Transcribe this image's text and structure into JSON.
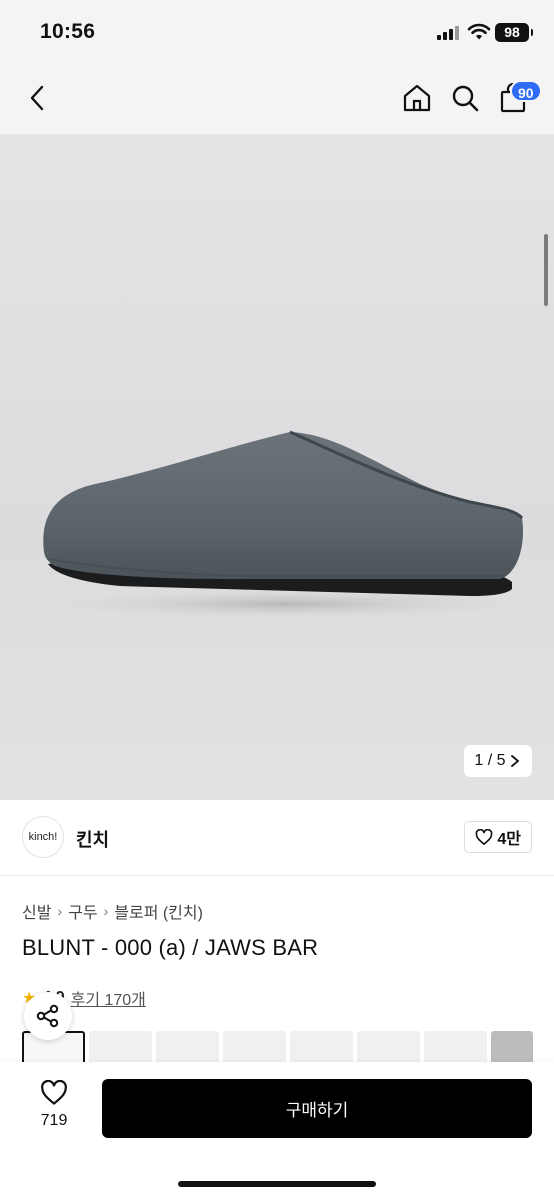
{
  "status_bar": {
    "time": "10:56",
    "battery": "98"
  },
  "nav": {
    "back_icon": "chevron-left-icon",
    "home_icon": "home-icon",
    "search_icon": "search-icon",
    "cart_icon": "shopping-bag-icon",
    "cart_count": "90"
  },
  "gallery": {
    "counter": "1 / 5",
    "next_icon": "chevron-right-icon"
  },
  "brand": {
    "logo_text": "kinch!",
    "name": "킨치",
    "like_count": "4만"
  },
  "breadcrumb": [
    "신발",
    "구두",
    "블로퍼 (킨치)"
  ],
  "product": {
    "title": "BLUNT - 000 (a) / JAWS BAR",
    "rating": "4.9",
    "review_link": "후기 170개"
  },
  "bottom": {
    "wish_count": "719",
    "buy_label": "구매하기"
  },
  "colors": {
    "accent": "#2e6cf6",
    "buy": "#000000",
    "star": "#f5b301"
  }
}
